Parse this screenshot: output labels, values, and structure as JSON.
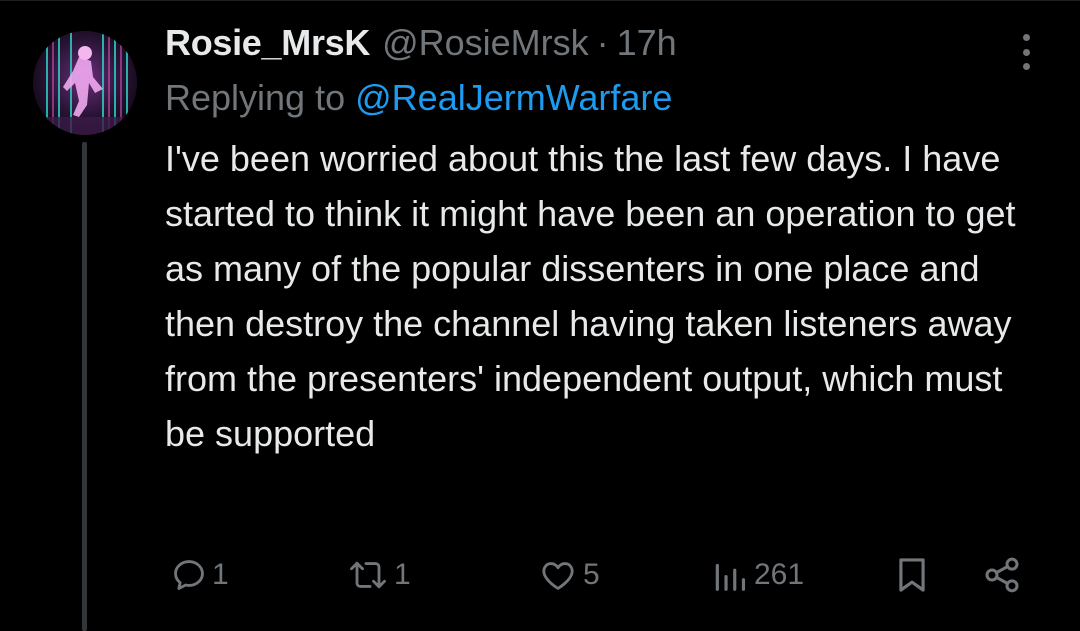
{
  "tweet": {
    "display_name": "Rosie_MrsK",
    "handle": "@RosieMrsk",
    "separator": "·",
    "time": "17h",
    "replying_label": "Replying to",
    "replying_to": "@RealJermWarfare",
    "text": "I've been worried about this the last few days. I have started to think it might have been an operation to get as many of the popular dissenters in one place and then destroy the channel having taken listeners away from the presenters' independent output, which must be supported"
  },
  "actions": {
    "replies": "1",
    "reposts": "1",
    "likes": "5",
    "views": "261"
  },
  "icons": {
    "more": "more-dots-icon",
    "reply": "reply-icon",
    "repost": "repost-icon",
    "like": "heart-icon",
    "views": "views-chart-icon",
    "bookmark": "bookmark-icon",
    "share": "share-icon"
  },
  "colors": {
    "background": "#000000",
    "text": "#e7e9ea",
    "secondary": "#71767b",
    "link": "#1d9bf0",
    "thread_line": "#333639"
  }
}
